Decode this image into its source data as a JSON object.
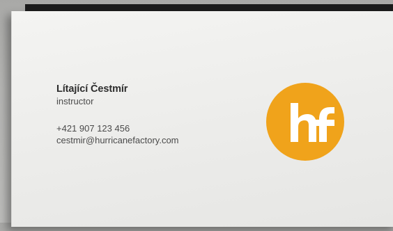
{
  "card": {
    "name": "Lítající Čestmír",
    "role": "instructor",
    "phone": "+421 907 123 456",
    "email": "cestmir@hurricanefactory.com"
  },
  "logo": {
    "icon": "hf-logo-icon",
    "color": "#f0a31b"
  }
}
